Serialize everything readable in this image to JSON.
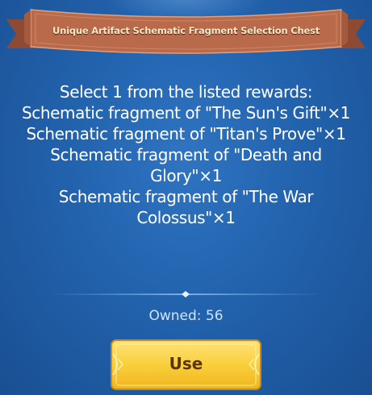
{
  "dialog": {
    "title": "Unique Artifact Schematic Fragment Selection Chest",
    "reward_lines": [
      "Select 1 from the listed rewards:",
      "Schematic fragment of \"The Sun's Gift\"×1",
      "Schematic fragment of \"Titan's Prove\"×1",
      "Schematic fragment of \"Death and",
      "Glory\"×1",
      "Schematic fragment of \"The War",
      "Colossus\"×1"
    ],
    "owned_label": "Owned: 56",
    "use_button_label": "Use"
  },
  "colors": {
    "background": "#2262ad",
    "ribbon": "#b86a4a",
    "button": "#f7cf3d",
    "button_text": "#5a3306"
  }
}
